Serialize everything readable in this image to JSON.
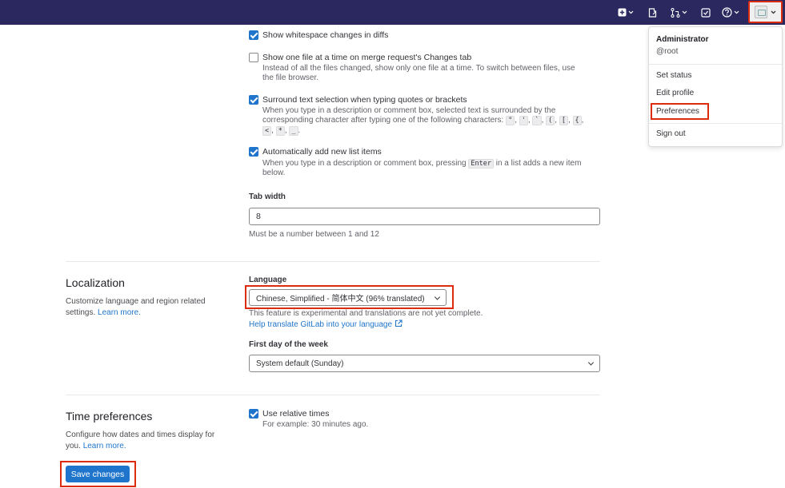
{
  "colors": {
    "topbar": "#2b2860",
    "accent": "#1f75cb",
    "highlight": "#dd2b0e"
  },
  "topbar": {
    "icons": [
      "plus-square-icon",
      "document-edit-icon",
      "merge-request-icon",
      "todo-check-icon",
      "help-icon",
      "user-avatar"
    ]
  },
  "behavior": {
    "whitespace": {
      "label": "Show whitespace changes in diffs",
      "checked": true
    },
    "one_file": {
      "label": "Show one file at a time on merge request's Changes tab",
      "help_1": "Instead of all the files changed, show only one file at a time. To switch between files, use",
      "help_2": "the file browser.",
      "checked": false
    },
    "surround": {
      "label": "Surround text selection when typing quotes or brackets",
      "help_1": "When you type in a description or comment box, selected text is surrounded by the",
      "help_2": "corresponding character after typing one of the following characters:",
      "chars": [
        "\"",
        "'",
        "`",
        "(",
        "[",
        "{",
        "<",
        "*",
        "_"
      ],
      "checked": true
    },
    "list_items": {
      "label": "Automatically add new list items",
      "help_pre": "When you type in a description or comment box, pressing",
      "help_key": "Enter",
      "help_post": "in a list adds a new item",
      "help_2": "below.",
      "checked": true
    },
    "tab_width": {
      "label": "Tab width",
      "value": "8",
      "help": "Must be a number between 1 and 12"
    }
  },
  "localization": {
    "title": "Localization",
    "desc": "Customize language and region related settings.",
    "learn_more": "Learn more.",
    "language_label": "Language",
    "language_value": "Chinese, Simplified - 简体中文 (96% translated)",
    "language_note": "This feature is experimental and translations are not yet complete.",
    "help_translate": "Help translate GitLab into your language",
    "first_day_label": "First day of the week",
    "first_day_value": "System default (Sunday)"
  },
  "time_prefs": {
    "title": "Time preferences",
    "desc": "Configure how dates and times display for you.",
    "learn_more": "Learn more.",
    "relative_label": "Use relative times",
    "relative_checked": true,
    "relative_help": "For example: 30 minutes ago."
  },
  "save_label": "Save changes",
  "user_menu": {
    "name": "Administrator",
    "username": "@root",
    "items": [
      "Set status",
      "Edit profile",
      "Preferences",
      "Sign out"
    ]
  }
}
